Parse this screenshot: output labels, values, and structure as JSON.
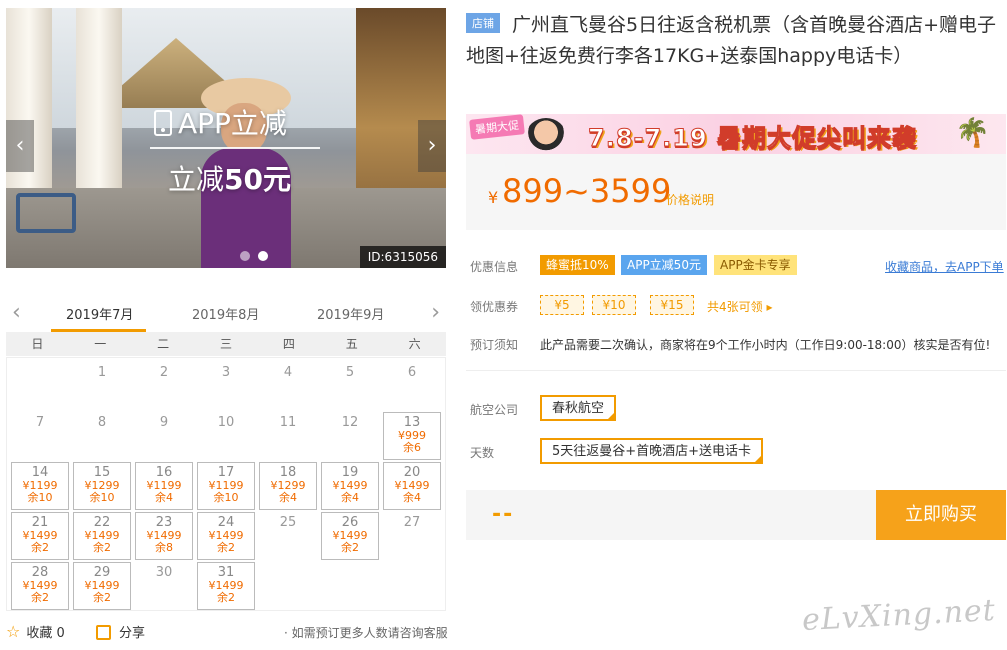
{
  "hero": {
    "overlay_line1": "APP立减",
    "overlay_line2_prefix": "立减",
    "overlay_line2_amount": "50元",
    "prev_arrow": "‹",
    "next_arrow": "›",
    "image_id": "ID:6315056"
  },
  "calendar": {
    "prev_arrow": "‹",
    "next_arrow": "›",
    "months": [
      "2019年7月",
      "2019年8月",
      "2019年9月"
    ],
    "weekdays": [
      "日",
      "一",
      "二",
      "三",
      "四",
      "五",
      "六"
    ],
    "days": [
      {
        "d": "1",
        "col": 1,
        "row": 0
      },
      {
        "d": "2",
        "col": 2,
        "row": 0
      },
      {
        "d": "3",
        "col": 3,
        "row": 0
      },
      {
        "d": "4",
        "col": 4,
        "row": 0
      },
      {
        "d": "5",
        "col": 5,
        "row": 0
      },
      {
        "d": "6",
        "col": 6,
        "row": 0
      },
      {
        "d": "7",
        "col": 0,
        "row": 1
      },
      {
        "d": "8",
        "col": 1,
        "row": 1
      },
      {
        "d": "9",
        "col": 2,
        "row": 1
      },
      {
        "d": "10",
        "col": 3,
        "row": 1
      },
      {
        "d": "11",
        "col": 4,
        "row": 1
      },
      {
        "d": "12",
        "col": 5,
        "row": 1
      },
      {
        "d": "13",
        "col": 6,
        "row": 1,
        "price": "¥999",
        "stock": "余6"
      },
      {
        "d": "14",
        "col": 0,
        "row": 2,
        "price": "¥1199",
        "stock": "余10"
      },
      {
        "d": "15",
        "col": 1,
        "row": 2,
        "price": "¥1299",
        "stock": "余10"
      },
      {
        "d": "16",
        "col": 2,
        "row": 2,
        "price": "¥1199",
        "stock": "余4"
      },
      {
        "d": "17",
        "col": 3,
        "row": 2,
        "price": "¥1199",
        "stock": "余10"
      },
      {
        "d": "18",
        "col": 4,
        "row": 2,
        "price": "¥1299",
        "stock": "余4"
      },
      {
        "d": "19",
        "col": 5,
        "row": 2,
        "price": "¥1499",
        "stock": "余4"
      },
      {
        "d": "20",
        "col": 6,
        "row": 2,
        "price": "¥1499",
        "stock": "余4"
      },
      {
        "d": "21",
        "col": 0,
        "row": 3,
        "price": "¥1499",
        "stock": "余2"
      },
      {
        "d": "22",
        "col": 1,
        "row": 3,
        "price": "¥1499",
        "stock": "余2"
      },
      {
        "d": "23",
        "col": 2,
        "row": 3,
        "price": "¥1499",
        "stock": "余8"
      },
      {
        "d": "24",
        "col": 3,
        "row": 3,
        "price": "¥1499",
        "stock": "余2"
      },
      {
        "d": "25",
        "col": 4,
        "row": 3
      },
      {
        "d": "26",
        "col": 5,
        "row": 3,
        "price": "¥1499",
        "stock": "余2"
      },
      {
        "d": "27",
        "col": 6,
        "row": 3
      },
      {
        "d": "28",
        "col": 0,
        "row": 4,
        "price": "¥1499",
        "stock": "余2"
      },
      {
        "d": "29",
        "col": 1,
        "row": 4,
        "price": "¥1499",
        "stock": "余2"
      },
      {
        "d": "30",
        "col": 2,
        "row": 4
      },
      {
        "d": "31",
        "col": 3,
        "row": 4,
        "price": "¥1499",
        "stock": "余2"
      }
    ]
  },
  "footer": {
    "favorite_label": "收藏",
    "favorite_count": "0",
    "share_label": "分享",
    "tip": "· 如需预订更多人数请咨询客服"
  },
  "product": {
    "shop_badge": "店铺",
    "title": "广州直飞曼谷5日往返含税机票（含首晚曼谷酒店+赠电子地图+往返免费行李各17KG+送泰国happy电话卡）",
    "banner_tag": "暑期大促",
    "banner_text": "7.8-7.19 暑期大促尖叫来袭",
    "currency": "¥",
    "price_range": "899~3599",
    "price_explain": "价格说明",
    "promo_label": "优惠信息",
    "promos": [
      "蜂蜜抵10%",
      "APP立减50元",
      "APP金卡专享"
    ],
    "favorite_link": "收藏商品，去APP下单",
    "coupon_label": "领优惠券",
    "coupons": [
      "¥5",
      "¥10",
      "¥15"
    ],
    "coupon_more": "共4张可领 ▸",
    "notice_label": "预订须知",
    "notice": "此产品需要二次确认，商家将在9个工作小时内（工作日9:00-18:00）核实是否有位!",
    "airline_label": "航空公司",
    "airline": "春秋航空",
    "days_label": "天数",
    "days_option": "5天往返曼谷+首晚酒店+送电话卡",
    "total_placeholder": "--",
    "buy_label": "立即购买"
  },
  "watermark": "eLvXing.net",
  "colors": {
    "accent": "#f29b00",
    "price": "#f06b00",
    "link": "#3a7bd5"
  }
}
